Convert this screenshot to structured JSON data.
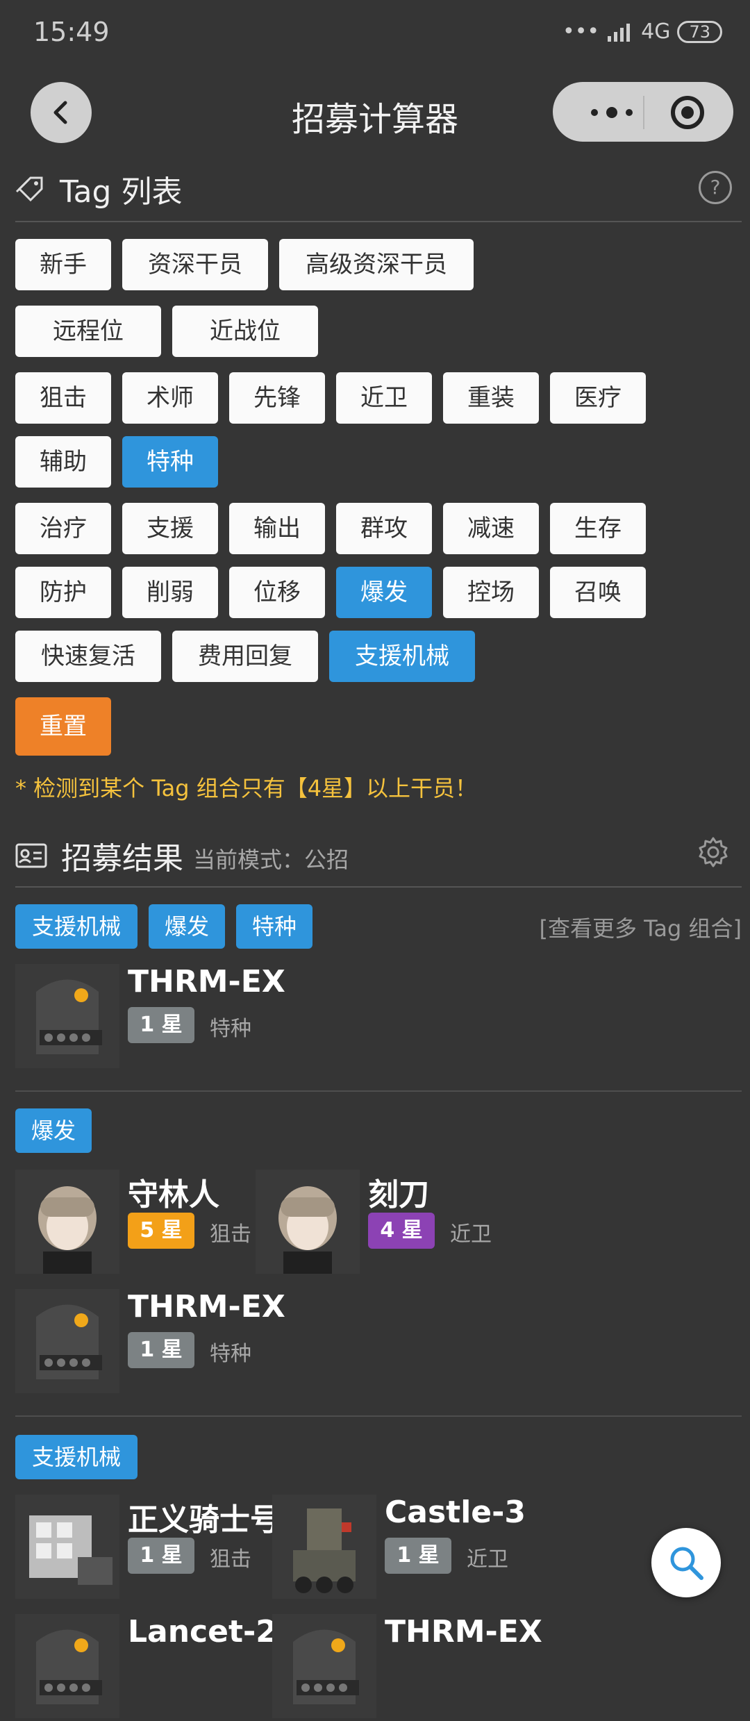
{
  "status": {
    "time": "15:49",
    "network": "4G",
    "battery": "73"
  },
  "nav": {
    "title": "招募计算器"
  },
  "tag_section": {
    "title": "Tag 列表",
    "help": "?"
  },
  "tags": {
    "row1": [
      "新手",
      "资深干员",
      "高级资深干员"
    ],
    "row2": [
      "远程位",
      "近战位"
    ],
    "row3": [
      "狙击",
      "术师",
      "先锋",
      "近卫",
      "重装",
      "医疗"
    ],
    "row4": [
      "辅助",
      "特种"
    ],
    "row5": [
      "治疗",
      "支援",
      "输出",
      "群攻",
      "减速",
      "生存"
    ],
    "row6": [
      "防护",
      "削弱",
      "位移",
      "爆发",
      "控场",
      "召唤"
    ],
    "row7": [
      "快速复活",
      "费用回复",
      "支援机械"
    ],
    "reset": "重置",
    "selected": [
      "特种",
      "爆发",
      "支援机械"
    ]
  },
  "warning": "* 检测到某个 Tag 组合只有【4星】以上干员！",
  "result_section": {
    "title": "招募结果",
    "mode": "当前模式：公招"
  },
  "groups": [
    {
      "tags": [
        "支援机械",
        "爆发",
        "特种"
      ],
      "more": "[查看更多 Tag 组合]",
      "operators": [
        {
          "name": "THRM-EX",
          "star": "1 星",
          "class": "特种",
          "avatar": "thrm-ex-avatar"
        }
      ]
    },
    {
      "tags": [
        "爆发"
      ],
      "operators": [
        {
          "name": "守林人",
          "star": "5 星",
          "class": "狙击",
          "avatar": "firewatch-avatar"
        },
        {
          "name": "刻刀",
          "star": "4 星",
          "class": "近卫",
          "avatar": "cutter-avatar"
        },
        {
          "name": "THRM-EX",
          "star": "1 星",
          "class": "特种",
          "avatar": "thrm-ex-avatar"
        }
      ]
    },
    {
      "tags": [
        "支援机械"
      ],
      "operators": [
        {
          "name": "正义骑士号",
          "star": "1 星",
          "class": "狙击",
          "avatar": "justice-knight-avatar"
        },
        {
          "name": "Castle-3",
          "star": "1 星",
          "class": "近卫",
          "avatar": "castle-3-avatar"
        },
        {
          "name": "Lancet-2",
          "star": "",
          "class": "",
          "avatar": "lancet-2-avatar"
        },
        {
          "name": "THRM-EX",
          "star": "",
          "class": "",
          "avatar": "thrm-ex-avatar"
        }
      ]
    }
  ],
  "icons": {
    "fab": "search-icon",
    "back": "back-arrow-icon",
    "settings": "gear-icon",
    "tag": "tag-icon",
    "card": "id-card-icon"
  },
  "colors": {
    "selected": "#2f95dc",
    "reset": "#ee8128",
    "warning": "#f5c23d",
    "star1": "#7c8284",
    "star4": "#8c42b4",
    "star5": "#f3a018"
  }
}
